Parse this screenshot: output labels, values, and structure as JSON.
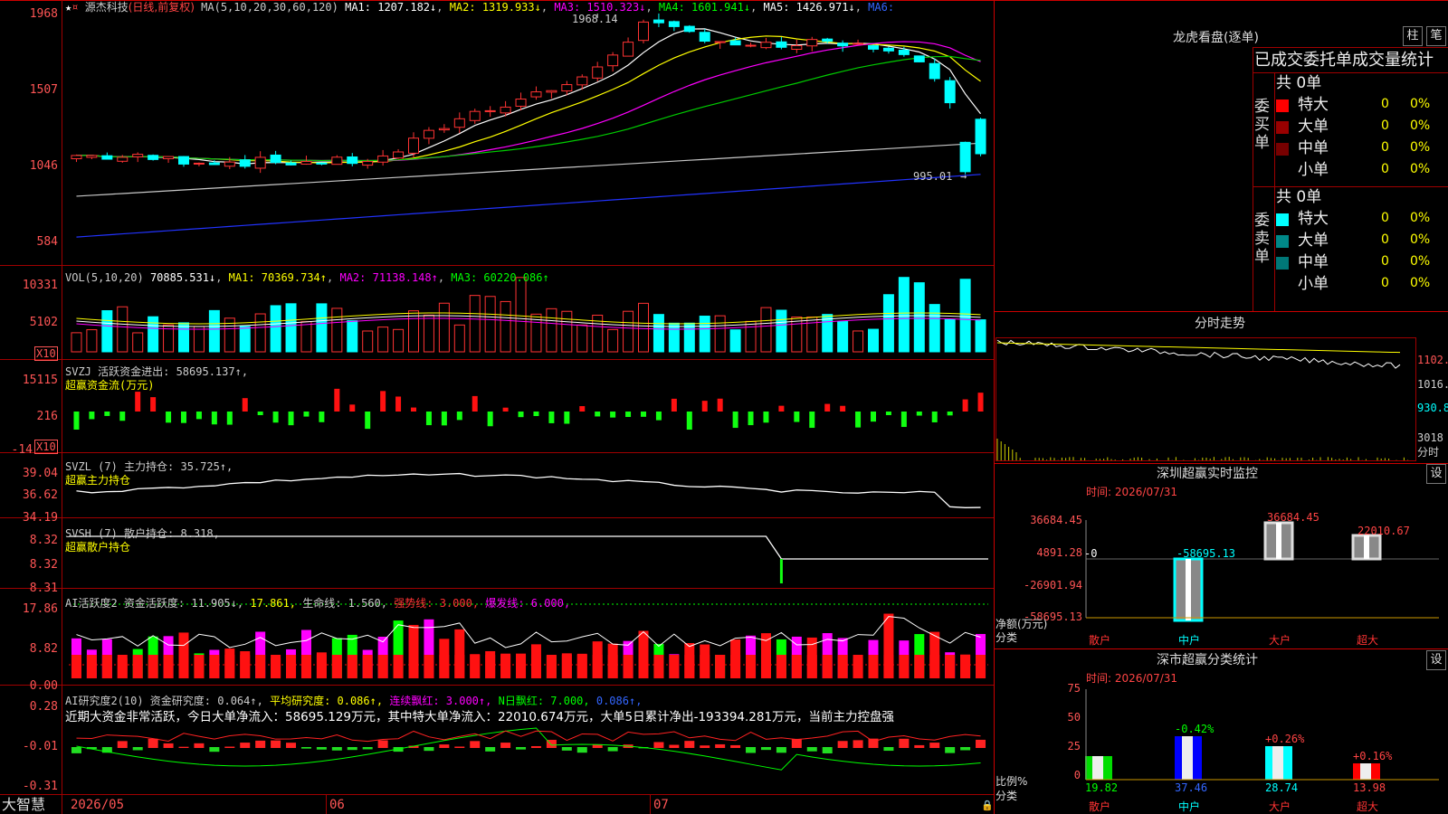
{
  "stock": {
    "name": "源杰科技",
    "mode": "(日线,前复权)"
  },
  "main": {
    "ma_label": "MA(5,10,20,30,60,120)",
    "ma": [
      {
        "label": "MA1: 1207.182↓",
        "color": "#ffffff"
      },
      {
        "label": "MA2: 1319.933↓",
        "color": "#ffff00"
      },
      {
        "label": "MA3: 1510.323↓",
        "color": "#ff00ff"
      },
      {
        "label": "MA4: 1601.941↓",
        "color": "#00ff00"
      },
      {
        "label": "MA5: 1426.971↓",
        "color": "#ffffff"
      },
      {
        "label": "MA6:",
        "color": "#3366ff"
      }
    ],
    "y_ticks": [
      "1968",
      "1507",
      "1046",
      "584"
    ],
    "high_label": "1968.14",
    "low_label": "995.01"
  },
  "vol": {
    "title": "VOL(5,10,20)",
    "value": "70885.531↓",
    "ma1": "MA1: 70369.734↑",
    "ma2": "MA2: 71138.148↑",
    "ma3": "MA3: 60220.086↑",
    "y_ticks": [
      "10331",
      "5102"
    ],
    "unit": "X10"
  },
  "svzj": {
    "title": "SVZJ  活跃资金进出: 58695.137↑,",
    "sub": "超赢资金流(万元)",
    "y_ticks": [
      "15115",
      "216",
      "-14"
    ],
    "unit": "X10"
  },
  "svzl": {
    "title": "SVZL (7) 主力持仓: 35.725↑,",
    "sub": "超赢主力持仓",
    "y_ticks": [
      "39.04",
      "36.62",
      "34.19"
    ]
  },
  "svsh": {
    "title": "SVSH (7) 散户持仓: 8.318,",
    "sub": "超赢散户持仓",
    "y_ticks": [
      "8.32",
      "8.32",
      "8.31"
    ]
  },
  "ai_active": {
    "title": "AI活跃度2 资金活跃度: 11.905↓,",
    "v2": "17.861,",
    "v3": "生命线: 1.560,",
    "v4": "强势线: 3.000,",
    "v5": "爆发线: 6.000,",
    "y_ticks": [
      "17.86",
      "8.82",
      "0.00"
    ]
  },
  "ai_research": {
    "title": "AI研究度2(10) 资金研究度: 0.064↑,",
    "v2": "平均研究度: 0.086↑,",
    "v3": "连续飘红: 3.000↑,",
    "v4": "N日飘红: 7.000,",
    "v5": "0.086↑,",
    "summary": "近期大资金非常活跃，今日大单净流入：58695.129万元，其中特大单净流入：22010.674万元，大单5日累计净出-193394.281万元，当前主力控盘强",
    "y_ticks": [
      "0.28",
      "-0.01",
      "-0.31"
    ]
  },
  "bottom": {
    "app": "大智慧",
    "dates": [
      "2026/05",
      "06",
      "07"
    ]
  },
  "right": {
    "lhb_title": "龙虎看盘(逐单)",
    "btn_bar": "柱",
    "btn_pen": "笔",
    "header": "已成交委托单成交量统计",
    "buy": {
      "side": "委买单",
      "count": "共 0单",
      "rows": [
        {
          "name": "特大",
          "v": "0",
          "p": "0%",
          "c": "#ff0000"
        },
        {
          "name": "大单",
          "v": "0",
          "p": "0%",
          "c": "#990000"
        },
        {
          "name": "中单",
          "v": "0",
          "p": "0%",
          "c": "#770000"
        },
        {
          "name": "小单",
          "v": "0",
          "p": "0%",
          "c": "#000000"
        }
      ]
    },
    "sell": {
      "side": "委卖单",
      "count": "共 0单",
      "rows": [
        {
          "name": "特大",
          "v": "0",
          "p": "0%",
          "c": "#00ffff"
        },
        {
          "name": "大单",
          "v": "0",
          "p": "0%",
          "c": "#008888"
        },
        {
          "name": "中单",
          "v": "0",
          "p": "0%",
          "c": "#007777"
        },
        {
          "name": "小单",
          "v": "0",
          "p": "0%",
          "c": "#000000"
        }
      ]
    },
    "fs_title": "分时走势",
    "fs_ticks": [
      "1102.",
      "1016.",
      "930.8",
      "3018",
      "分时"
    ],
    "monitor_title": "深圳超赢实时监控",
    "set": "设",
    "time1": "时间: 2026/07/31",
    "m_ticks": [
      "36684.45",
      "4891.28",
      "-26901.94",
      "-58695.13"
    ],
    "m_values": [
      "-0",
      "-58695.13",
      "36684.45",
      "22010.67"
    ],
    "m_unit": "净额(万元)",
    "m_cat": "分类",
    "cats": [
      "散户",
      "中户",
      "大户",
      "超大"
    ],
    "cls_title": "深市超赢分类统计",
    "time2": "时间: 2026/07/31",
    "c_ticks": [
      "75",
      "50",
      "25",
      "0"
    ],
    "c_top": [
      "",
      "-0.42%",
      "+0.26%",
      "+0.16%"
    ],
    "c_vals": [
      "19.82",
      "37.46",
      "28.74",
      "13.98"
    ],
    "c_unit": "比例%",
    "c_cat": "分类"
  }
}
